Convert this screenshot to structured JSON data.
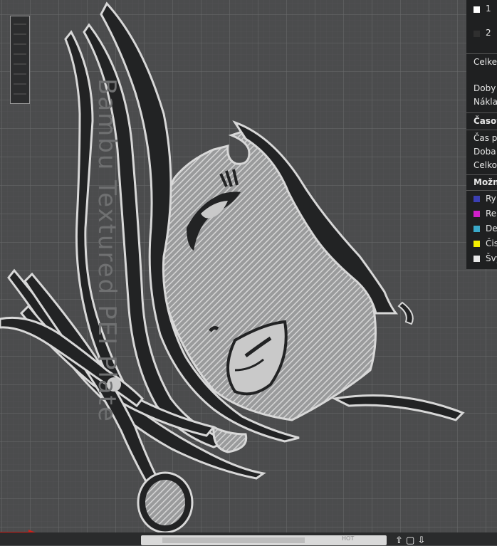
{
  "plate": {
    "label": "Bambu Textured PEI Plate"
  },
  "stats_panel": {
    "filaments": [
      {
        "index": "1",
        "color": "#ffffff"
      },
      {
        "index": "2",
        "color": "#2f2f2f"
      }
    ],
    "summary_rows": [
      "Celke",
      "Doby",
      "Nákla"
    ],
    "time_section": {
      "title": "Časov",
      "rows": [
        "Čas p",
        "Doba",
        "Celko"
      ]
    },
    "options_section": {
      "title": "Možn",
      "items": [
        {
          "label": "Ry",
          "color": "#3b3fb3"
        },
        {
          "label": "Re",
          "color": "#d01fc9"
        },
        {
          "label": "De",
          "color": "#3aa9c9"
        },
        {
          "label": "Čis",
          "color": "#f5ef00"
        },
        {
          "label": "Švy",
          "color": "#e8e8e8"
        }
      ]
    }
  },
  "bottom_bar": {
    "mode_label": "HOT"
  },
  "colors": {
    "background": "#4b4c4d",
    "grid": "#6b6c6d",
    "model_dark": "#222324",
    "model_light": "#c8c8c8",
    "outline": "#d0d0d0",
    "axis_x": "#d0201a"
  }
}
